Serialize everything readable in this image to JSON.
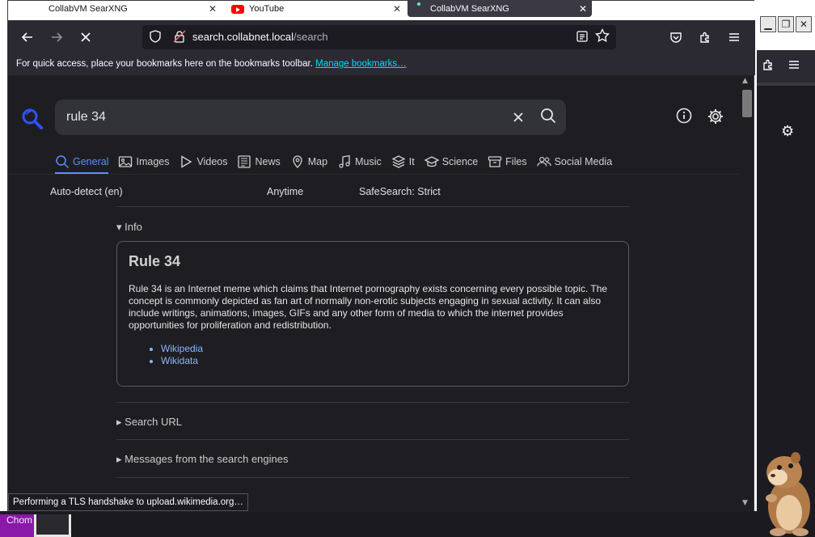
{
  "tabs": [
    {
      "title": "CollabVM SearXNG",
      "close": "✕"
    },
    {
      "title": "YouTube",
      "close": "✕"
    },
    {
      "title": "CollabVM SearXNG",
      "close": "✕"
    }
  ],
  "navbar": {
    "url_host": "search.collabnet.local",
    "url_path": "/search"
  },
  "bookmarks_bar": {
    "message": "For quick access, place your bookmarks here on the bookmarks toolbar.",
    "link": "Manage bookmarks…"
  },
  "search": {
    "query": "rule 34"
  },
  "categories": [
    {
      "label": "General",
      "icon": "search-icon",
      "active": true
    },
    {
      "label": "Images",
      "icon": "image-icon",
      "active": false
    },
    {
      "label": "Videos",
      "icon": "play-icon",
      "active": false
    },
    {
      "label": "News",
      "icon": "newspaper-icon",
      "active": false
    },
    {
      "label": "Map",
      "icon": "map-pin-icon",
      "active": false
    },
    {
      "label": "Music",
      "icon": "music-icon",
      "active": false
    },
    {
      "label": "It",
      "icon": "layers-icon",
      "active": false
    },
    {
      "label": "Science",
      "icon": "school-icon",
      "active": false
    },
    {
      "label": "Files",
      "icon": "archive-icon",
      "active": false
    },
    {
      "label": "Social Media",
      "icon": "people-icon",
      "active": false
    }
  ],
  "filters": {
    "language": "Auto-detect (en)",
    "time_range": "Anytime",
    "safesearch": "SafeSearch: Strict"
  },
  "infobox": {
    "summary": "Info",
    "title": "Rule 34",
    "content": "Rule 34 is an Internet meme which claims that Internet pornography exists concerning every possible topic. The concept is commonly depicted as fan art of normally non-erotic subjects engaging in sexual activity. It can also include writings, animations, images, GIFs and any other form of media to which the internet provides opportunities for proliferation and redistribution.",
    "links": [
      "Wikipedia",
      "Wikidata"
    ]
  },
  "sections": {
    "search_url": "Search URL",
    "messages": "Messages from the search engines"
  },
  "status": "Performing a TLS handshake to upload.wikimedia.org…",
  "taskbar": {
    "chrome_label": "Chom"
  },
  "colors": {
    "accent": "#5c8cff",
    "link": "#8cb4ff",
    "bookmark_link": "#00ddff",
    "toolbar": "#2b2a33",
    "page_bg": "#1e1e22"
  }
}
